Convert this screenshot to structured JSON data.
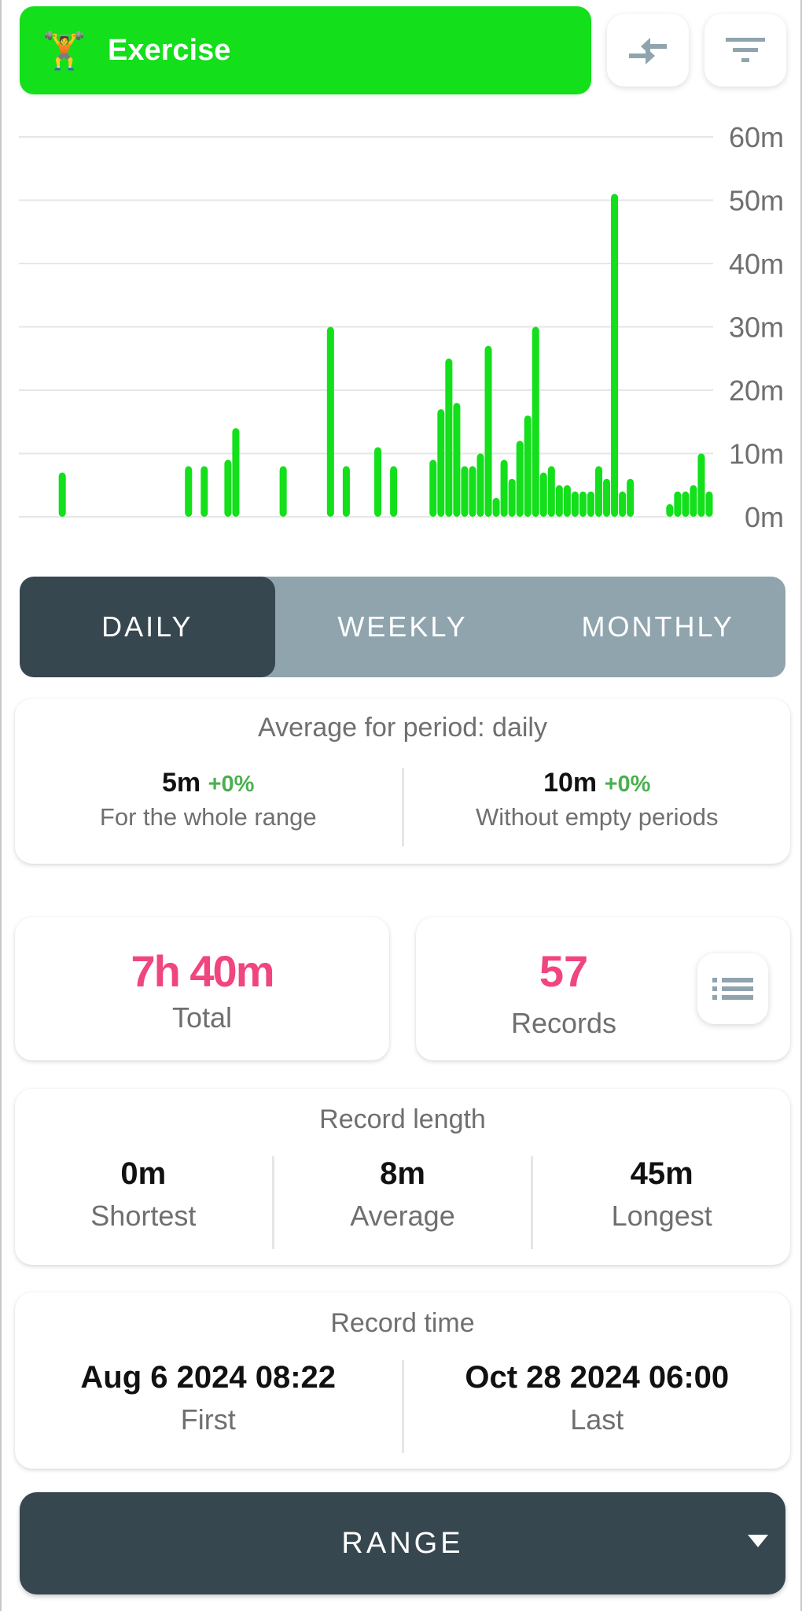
{
  "header": {
    "emoji": "🏋️",
    "title": "Exercise",
    "accent_color": "#13df1b",
    "compare_icon": "compare-arrows-icon",
    "filter_icon": "filter-icon"
  },
  "chart_data": {
    "type": "bar",
    "title": "",
    "xlabel": "",
    "ylabel": "",
    "x_range": [
      "Aug 6 2024",
      "Oct 28 2024"
    ],
    "ylim": [
      0,
      60
    ],
    "y_ticks": [
      "0m",
      "10m",
      "20m",
      "30m",
      "40m",
      "50m",
      "60m"
    ],
    "y_tick_values": [
      0,
      10,
      20,
      30,
      40,
      50,
      60
    ],
    "y_axis_side": "right",
    "grid": true,
    "color": "#13df1b",
    "unit": "minutes",
    "bars": [
      {
        "day": 5,
        "value": 7
      },
      {
        "day": 21,
        "value": 8
      },
      {
        "day": 23,
        "value": 8
      },
      {
        "day": 26,
        "value": 9
      },
      {
        "day": 27,
        "value": 14
      },
      {
        "day": 33,
        "value": 8
      },
      {
        "day": 39,
        "value": 30
      },
      {
        "day": 41,
        "value": 8
      },
      {
        "day": 45,
        "value": 11
      },
      {
        "day": 47,
        "value": 8
      },
      {
        "day": 52,
        "value": 9
      },
      {
        "day": 53,
        "value": 17
      },
      {
        "day": 54,
        "value": 25
      },
      {
        "day": 55,
        "value": 18
      },
      {
        "day": 56,
        "value": 8
      },
      {
        "day": 57,
        "value": 8
      },
      {
        "day": 58,
        "value": 10
      },
      {
        "day": 59,
        "value": 27
      },
      {
        "day": 60,
        "value": 3
      },
      {
        "day": 61,
        "value": 9
      },
      {
        "day": 62,
        "value": 6
      },
      {
        "day": 63,
        "value": 12
      },
      {
        "day": 64,
        "value": 16
      },
      {
        "day": 65,
        "value": 30
      },
      {
        "day": 66,
        "value": 7
      },
      {
        "day": 67,
        "value": 8
      },
      {
        "day": 68,
        "value": 5
      },
      {
        "day": 69,
        "value": 5
      },
      {
        "day": 70,
        "value": 4
      },
      {
        "day": 71,
        "value": 4
      },
      {
        "day": 72,
        "value": 4
      },
      {
        "day": 73,
        "value": 8
      },
      {
        "day": 74,
        "value": 6
      },
      {
        "day": 75,
        "value": 51
      },
      {
        "day": 76,
        "value": 4
      },
      {
        "day": 77,
        "value": 6
      },
      {
        "day": 82,
        "value": 2
      },
      {
        "day": 83,
        "value": 4
      },
      {
        "day": 84,
        "value": 4
      },
      {
        "day": 85,
        "value": 5
      },
      {
        "day": 86,
        "value": 10
      },
      {
        "day": 87,
        "value": 4
      }
    ],
    "total_days": 88
  },
  "period_tabs": [
    {
      "label": "DAILY",
      "active": true
    },
    {
      "label": "WEEKLY",
      "active": false
    },
    {
      "label": "MONTHLY",
      "active": false
    }
  ],
  "average": {
    "title": "Average for period: daily",
    "whole_range": {
      "value": "5m",
      "delta": "+0%",
      "label": "For the whole range"
    },
    "without_empty": {
      "value": "10m",
      "delta": "+0%",
      "label": "Without empty periods"
    }
  },
  "total": {
    "value": "7h 40m",
    "label": "Total"
  },
  "records": {
    "value": "57",
    "label": "Records",
    "list_icon": "list-icon"
  },
  "record_length": {
    "title": "Record length",
    "items": [
      {
        "value": "0m",
        "label": "Shortest"
      },
      {
        "value": "8m",
        "label": "Average"
      },
      {
        "value": "45m",
        "label": "Longest"
      }
    ]
  },
  "record_time": {
    "title": "Record time",
    "first": {
      "value": "Aug 6 2024 08:22",
      "label": "First"
    },
    "last": {
      "value": "Oct 28 2024 06:00",
      "label": "Last"
    }
  },
  "range_button": {
    "label": "RANGE"
  },
  "colors": {
    "accent": "#13df1b",
    "highlight": "#f0457f",
    "positive": "#4caf50",
    "dark": "#37474f",
    "tab_inactive": "#90a4ae"
  }
}
